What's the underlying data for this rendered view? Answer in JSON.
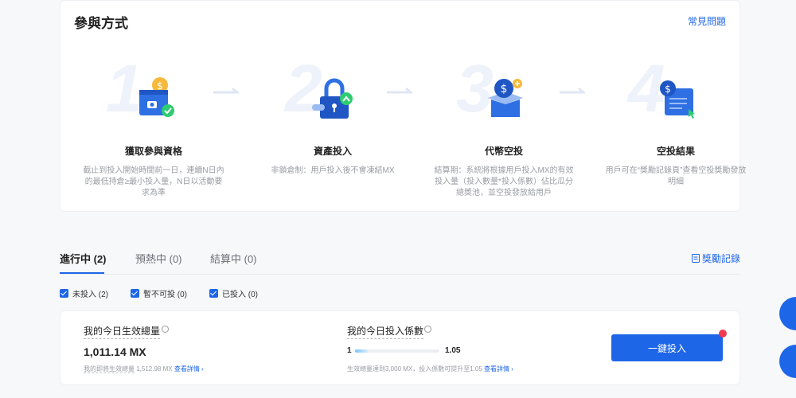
{
  "participation": {
    "title": "參與方式",
    "faq_label": "常見問題",
    "steps": [
      {
        "num": "1",
        "name": "獲取參與資格",
        "desc": "截止到投入開始時間前一日，連續N日內的最低持倉≥最小投入量，N日以活動要求為準"
      },
      {
        "num": "2",
        "name": "資產投入",
        "desc": "非鎖倉制：用戶投入後不會凍結MX"
      },
      {
        "num": "3",
        "name": "代幣空投",
        "desc": "結算期：系統將根據用戶投入MX的有效投入量（投入數量*投入係數）佔比瓜分總獎池，並空投發放給用戶"
      },
      {
        "num": "4",
        "name": "空投結果",
        "desc": "用戶可在“獎勵記錄頁”查看空投獎勵發放明細"
      }
    ]
  },
  "tabs": [
    {
      "label": "進行中 (2)"
    },
    {
      "label": "預熱中 (0)"
    },
    {
      "label": "結算中 (0)"
    }
  ],
  "rewards_link": "獎勵記錄",
  "filters": [
    {
      "label": "未投入 (2)",
      "checked": true
    },
    {
      "label": "暫不可投 (0)",
      "checked": true
    },
    {
      "label": "已投入 (0)",
      "checked": true
    }
  ],
  "summary": {
    "effective_label": "我的今日生效總量",
    "effective_value": "1,011.14 MX",
    "upcoming_label": "我的即將生效總量",
    "upcoming_value": "1,512.98 MX",
    "view_detail": "查看詳情",
    "coef_label": "我的今日投入係數",
    "coef_min": "1",
    "coef_max": "1.05",
    "coef_progress": 0.15,
    "coef_hint": "生效總量達到3,000 MX，投入係數可提升至1.05",
    "invest_button": "一鍵投入"
  },
  "colors": {
    "accent": "#1e66e8",
    "badge": "#f03a4e",
    "check": "#2ecc71"
  }
}
